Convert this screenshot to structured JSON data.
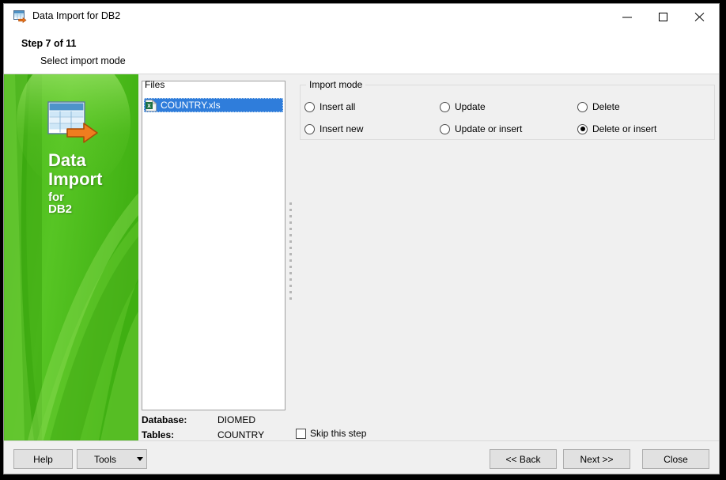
{
  "window": {
    "title": "Data Import for DB2",
    "icon": "data-import-icon",
    "controls": {
      "minimize": "minimize-icon",
      "maximize": "maximize-icon",
      "close": "close-icon"
    }
  },
  "header": {
    "step": "Step 7 of 11",
    "subtitle": "Select import mode"
  },
  "brand": {
    "line1": "Data",
    "line2": "Import",
    "line3": "for",
    "line4": "DB2",
    "icon": "spreadsheet-import-icon",
    "color_light": "#7ad63f",
    "color_mid": "#4fbf1e",
    "color_dark": "#33a30d"
  },
  "files": {
    "label": "Files",
    "items": [
      {
        "name": "COUNTRY.xls",
        "icon": "excel-file-icon",
        "selected": true
      }
    ]
  },
  "info": {
    "database_label": "Database:",
    "database_value": "DIOMED",
    "tables_label": "Tables:",
    "tables_value": "COUNTRY"
  },
  "skip": {
    "label": "Skip this step",
    "checked": false
  },
  "import_mode": {
    "title": "Import mode",
    "options": [
      {
        "label": "Insert all",
        "checked": false
      },
      {
        "label": "Insert new",
        "checked": false
      },
      {
        "label": "Update",
        "checked": false
      },
      {
        "label": "Update or insert",
        "checked": false
      },
      {
        "label": "Delete",
        "checked": false
      },
      {
        "label": "Delete or insert",
        "checked": true
      }
    ]
  },
  "footer": {
    "help": "Help",
    "tools": "Tools",
    "back": "<< Back",
    "next": "Next >>",
    "close": "Close"
  }
}
